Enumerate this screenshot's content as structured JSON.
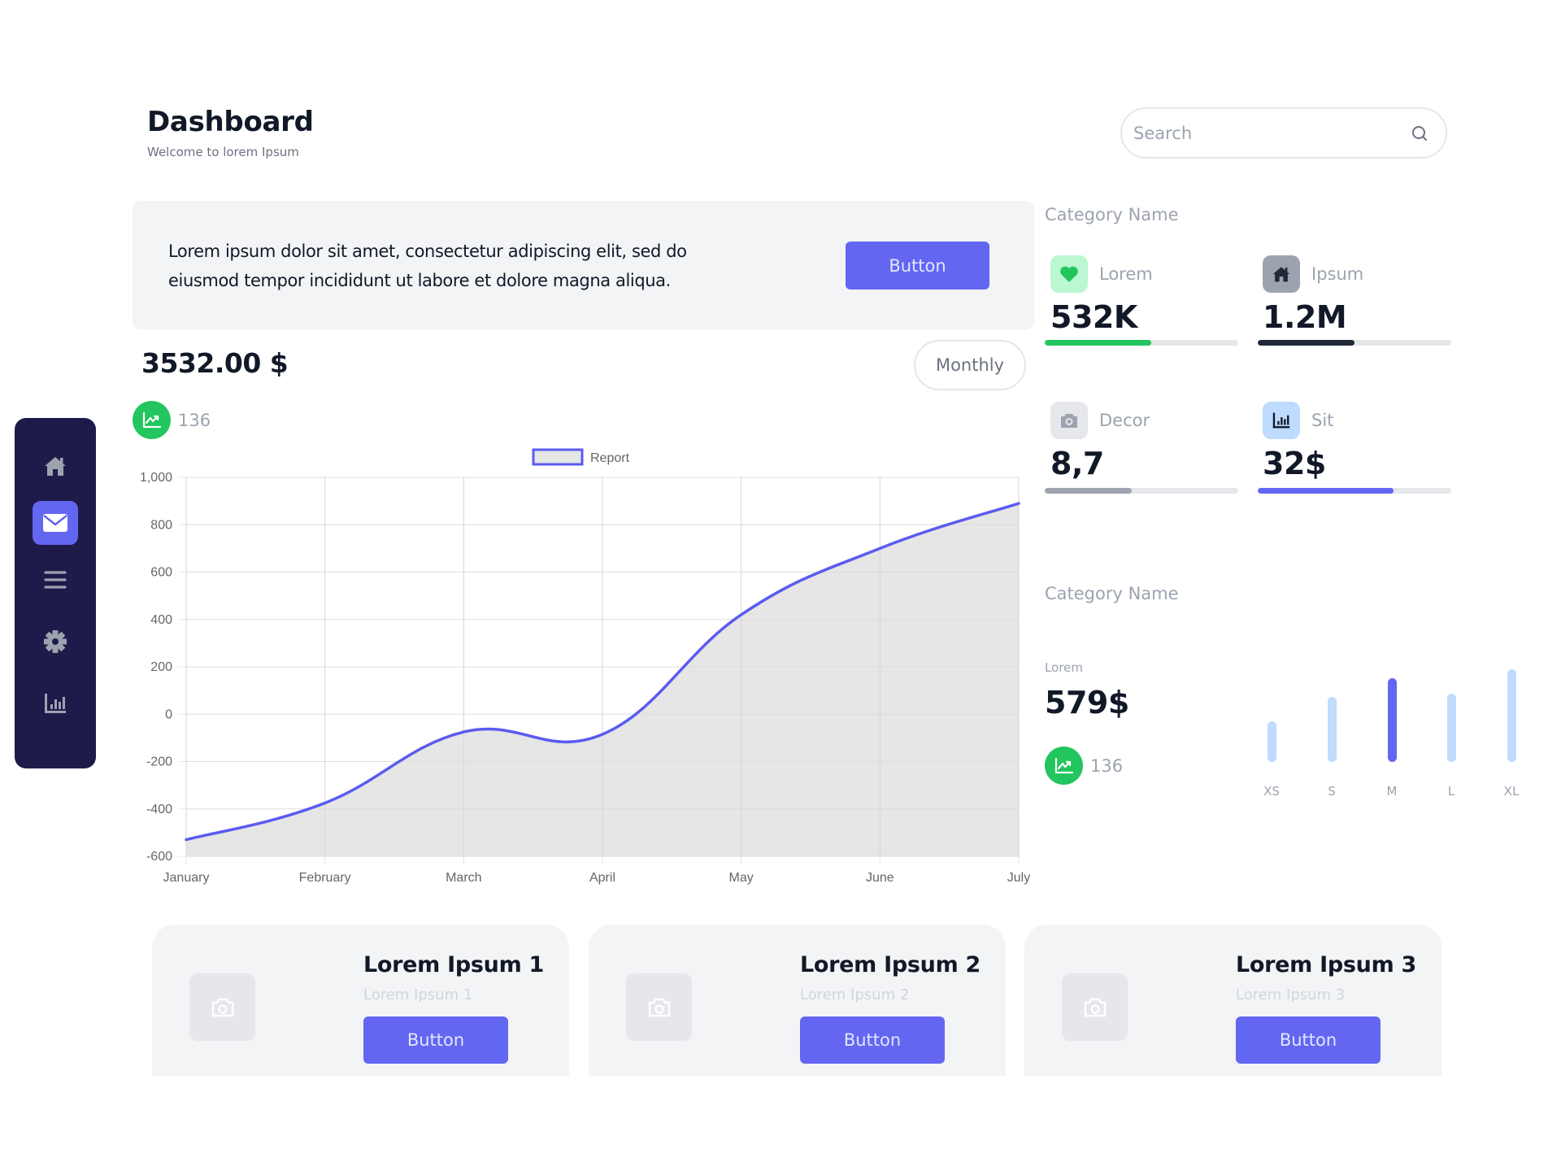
{
  "header": {
    "title": "Dashboard",
    "subtitle": "Welcome to lorem Ipsum",
    "search_placeholder": "Search",
    "search_value": ""
  },
  "banner": {
    "text": "Lorem ipsum dolor sit amet, consectetur adipiscing elit, sed do eiusmod tempor incididunt ut labore et dolore magna aliqua.",
    "button_label": "Button"
  },
  "summary": {
    "total": "3532.00 $",
    "period_button": "Monthly",
    "trend_count": "136"
  },
  "sidebar": {
    "items": [
      {
        "name": "home",
        "icon": "home-icon",
        "active": false
      },
      {
        "name": "mail",
        "icon": "mail-icon",
        "active": true
      },
      {
        "name": "menu",
        "icon": "menu-icon",
        "active": false
      },
      {
        "name": "settings",
        "icon": "gear-icon",
        "active": false
      },
      {
        "name": "analytics",
        "icon": "bar-chart-icon",
        "active": false
      }
    ]
  },
  "chart_data": {
    "type": "area",
    "title": "",
    "legend": [
      "Report"
    ],
    "legend_position": "top-center",
    "categories": [
      "January",
      "February",
      "March",
      "April",
      "May",
      "June",
      "July"
    ],
    "series": [
      {
        "name": "Report",
        "values": [
          -530,
          -375,
          -75,
          -85,
          420,
          700,
          890
        ],
        "color": "#5b5bf0",
        "fill": "#e5e5e5"
      }
    ],
    "yticks": [
      "1,000",
      "800",
      "600",
      "400",
      "200",
      "0",
      "-200",
      "-400",
      "-600"
    ],
    "ylim": [
      -600,
      1000
    ],
    "xlabel": "",
    "ylabel": "",
    "grid": true
  },
  "stats": {
    "category_title": "Category Name",
    "items": [
      {
        "label": "Lorem",
        "value": "532K",
        "progress": 0.55,
        "icon": "heart-icon",
        "color": "#22c55e",
        "icon_bg": "#bbf7d0",
        "icon_color": "#22c55e"
      },
      {
        "label": "Ipsum",
        "value": "1.2M",
        "progress": 0.5,
        "icon": "home-icon",
        "color": "#1f2937",
        "icon_bg": "#9ca3af",
        "icon_color": "#1f2937"
      },
      {
        "label": "Decor",
        "value": "8,7",
        "progress": 0.45,
        "icon": "camera-icon",
        "color": "#9ca3af",
        "icon_bg": "#e5e7eb",
        "icon_color": "#9ca3af"
      },
      {
        "label": "Sit",
        "value": "32$",
        "progress": 0.7,
        "icon": "bar-chart-icon",
        "color": "#6366f1",
        "icon_bg": "#bfdbfe",
        "icon_color": "#111827"
      }
    ]
  },
  "sizes": {
    "category_title": "Category Name",
    "label": "Lorem",
    "value": "579$",
    "trend_count": "136",
    "bars": [
      {
        "label": "XS",
        "value": 0.44,
        "highlight": false
      },
      {
        "label": "S",
        "value": 0.7,
        "highlight": false
      },
      {
        "label": "M",
        "value": 0.9,
        "highlight": true
      },
      {
        "label": "L",
        "value": 0.74,
        "highlight": false
      },
      {
        "label": "XL",
        "value": 1.0,
        "highlight": false
      }
    ]
  },
  "cards": [
    {
      "title": "Lorem Ipsum 1",
      "subtitle": "Lorem Ipsum 1",
      "button_label": "Button"
    },
    {
      "title": "Lorem Ipsum 2",
      "subtitle": "Lorem Ipsum 2",
      "button_label": "Button"
    },
    {
      "title": "Lorem Ipsum 3",
      "subtitle": "Lorem Ipsum 3",
      "button_label": "Button"
    }
  ],
  "colors": {
    "accent": "#6366f1",
    "sidebar_bg": "#1e1b4b",
    "success": "#22c55e",
    "panel_bg": "#f3f4f6",
    "bar_light": "#bfdbfe"
  }
}
